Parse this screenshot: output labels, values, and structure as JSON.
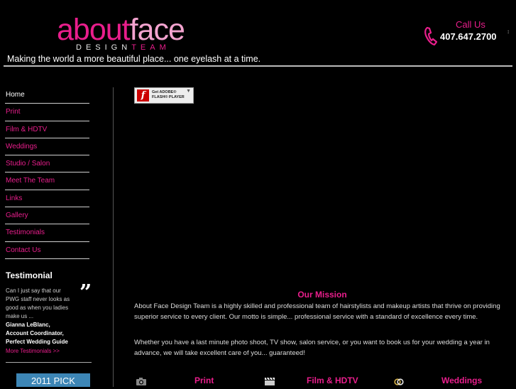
{
  "logo": {
    "about": "about",
    "face": "face",
    "sub_design": "DESIGN",
    "sub_team": "TEAM"
  },
  "tagline": "Making the world a more beautiful place... one eyelash at a time.",
  "contact": {
    "call_label": "Call Us",
    "phone": "407.647.2700"
  },
  "nav": {
    "items": [
      {
        "label": "Home"
      },
      {
        "label": "Print"
      },
      {
        "label": "Film & HDTV"
      },
      {
        "label": "Weddings"
      },
      {
        "label": "Studio / Salon"
      },
      {
        "label": "Meet The Team"
      },
      {
        "label": "Links"
      },
      {
        "label": "Gallery"
      },
      {
        "label": "Testimonials"
      },
      {
        "label": "Contact Us"
      }
    ]
  },
  "testimonial": {
    "title": "Testimonial",
    "text": "Can I just say that our PWG staff never looks as good as when you ladies make us ...",
    "author_name": "Gianna LeBlanc,",
    "author_role": "Account Coordinator,",
    "author_org": "Perfect Wedding Guide",
    "more_link": "More Testimonials >>"
  },
  "badge": {
    "year": "2011",
    "label": "PICK"
  },
  "flash": {
    "line1": "Get ADOBE®",
    "line2": "FLASH® PLAYER"
  },
  "mission": {
    "title": "Our Mission",
    "p1": "About Face Design Team is a highly skilled and professional team of hairstylists and makeup artists that thrive on providing superior service to every client. Our motto is simple... professional service with a standard of excellence every time.",
    "p2": "Whether you have a last minute photo shoot, TV show, salon service, or you want to book us for your wedding a year in advance, we will take excellent care of you... guaranteed!"
  },
  "bottom_nav": {
    "items": [
      {
        "label": "Print",
        "icon": "camera-icon"
      },
      {
        "label": "Film & HDTV",
        "icon": "clapperboard-icon"
      },
      {
        "label": "Weddings",
        "icon": "rings-icon"
      }
    ]
  },
  "colors": {
    "accent": "#e91e8c",
    "accent_light": "#f3a3cf",
    "background": "#000000",
    "badge": "#3d86b6"
  }
}
